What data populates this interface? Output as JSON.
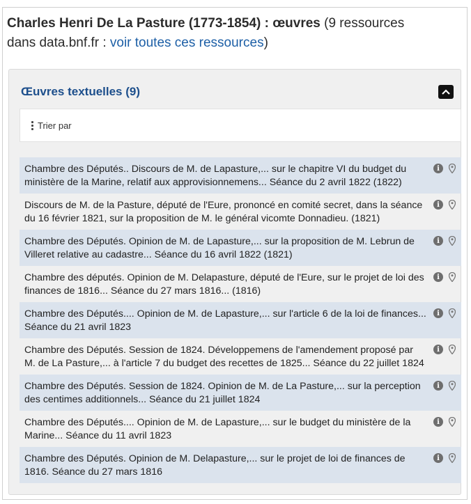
{
  "header": {
    "author": "Charles Henri De La Pasture (1773-1854) : œuvres",
    "count_text": " (9 ressources dans data.bnf.fr : ",
    "link_label": "voir toutes ces ressources",
    "closing": ")"
  },
  "panel": {
    "title": "Œuvres textuelles (9)",
    "toggle_icon": "chevron-up-icon",
    "sort_label": "Trier par"
  },
  "colors": {
    "accent": "#1d4f8c",
    "link": "#1d5fa6",
    "row_highlight": "#dbe3ed"
  },
  "works": [
    "Chambre des Députés.. Discours de M. de Lapasture,... sur le chapitre VI du budget du ministère de la Marine, relatif aux approvisionnemens... Séance du 2 avril 1822 (1822)",
    "Discours de M. de la Pasture, député de l'Eure, prononcé en comité secret, dans la séance du 16 février 1821, sur la proposition de M. le général vicomte Donnadieu. (1821)",
    "Chambre des Députés. Opinion de M. de Lapasture,... sur la proposition de M. Lebrun de Villeret relative au cadastre... Séance du 16 avril 1822 (1821)",
    "Chambre des députés. Opinion de M. Delapasture, député de l'Eure, sur le projet de loi des finances de 1816... Séance du 27 mars 1816... (1816)",
    "Chambre des Députés.... Opinion de M. de Lapasture,... sur l'article 6 de la loi de finances... Séance du 21 avril 1823",
    "Chambre des Députés. Session de 1824. Développemens de l'amendement proposé par M. de La Pasture,... à l'article 7 du budget des recettes de 1825... Séance du 22 juillet 1824",
    "Chambre des Députés. Session de 1824. Opinion de M. de La Pasture,... sur la perception des centimes additionnels... Séance du 21 juillet 1824",
    "Chambre des Députés.... Opinion de M. de Lapasture,... sur le budget du ministère de la Marine... Séance du 11 avril 1823",
    "Chambre des Députés. Opinion de M. Delapasture,... sur le projet de loi de finances de 1816. Séance du 27 mars 1816"
  ]
}
